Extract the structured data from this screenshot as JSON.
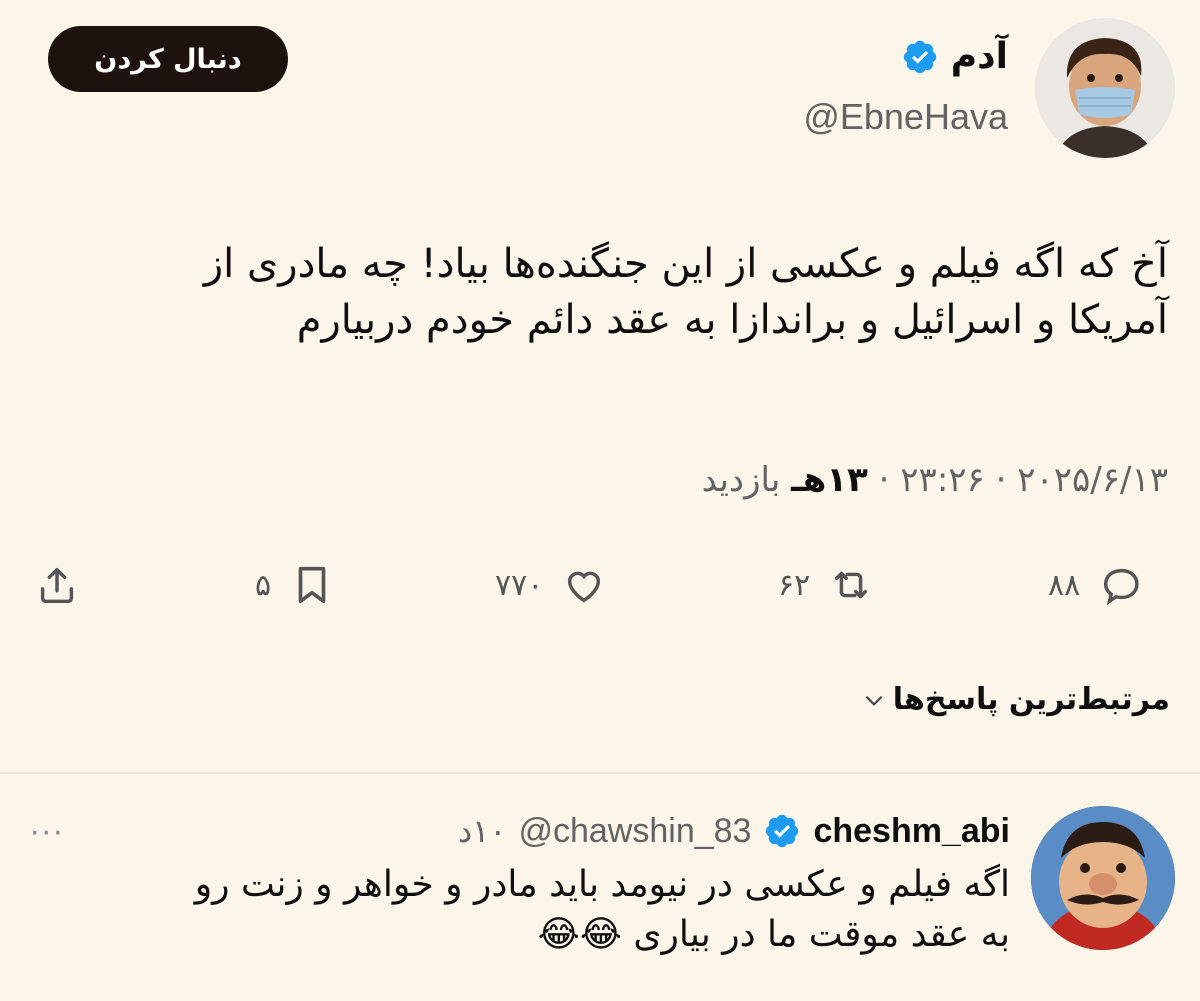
{
  "header": {
    "follow_label": "دنبال کردن",
    "display_name": "آدم",
    "handle": "@EbneHava"
  },
  "tweet": {
    "text_line1": "آخ که اگه فیلم و عکسی از این جنگنده‌ها بیاد! چه مادری از",
    "text_line2": "آمریکا و اسرائیل و براندازا به عقد دائم خودم دربیارم",
    "date": "۲۰۲۵/۶/۱۳",
    "time": "۲۳:۲۶",
    "views_count": "۱۳هـ",
    "views_label": "بازدید"
  },
  "actions": {
    "replies": "۸۸",
    "retweets": "۶۲",
    "likes": "۷۷۰",
    "bookmarks": "۵"
  },
  "sort": {
    "label": "مرتبط‌ترین پاسخ‌ها"
  },
  "reply": {
    "name": "cheshm_abi",
    "handle": "@chawshin_83",
    "time": "۱۰د",
    "more": "···",
    "text_line1": "اگه فیلم و عکسی در نیومد باید مادر و خواهر و زنت رو",
    "text_line2": "به عقد موقت ما در بیاری",
    "emojis": "😂😂"
  },
  "colors": {
    "background": "#fcf6ea",
    "verified": "#1d9bf0",
    "follow_button": "#1d120d"
  }
}
